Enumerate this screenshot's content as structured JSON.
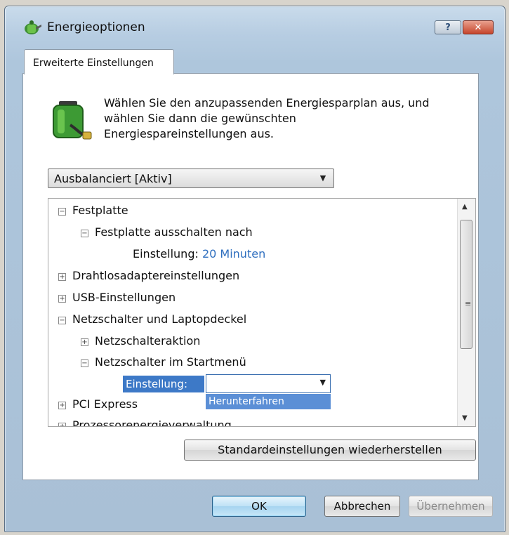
{
  "window": {
    "title": "Energieoptionen",
    "help_label": "?",
    "close_label": "✕"
  },
  "tab": {
    "label": "Erweiterte Einstellungen"
  },
  "intro": {
    "line1": "Wählen Sie den anzupassenden Energiesparplan aus, und",
    "line2": "wählen Sie dann die gewünschten",
    "line3": "Energiespareinstellungen aus."
  },
  "plan_select": {
    "value": "Ausbalanciert [Aktiv]"
  },
  "tree": {
    "items": [
      {
        "label": "Festplatte",
        "toggle": "⊟"
      },
      {
        "label": "Festplatte ausschalten nach",
        "toggle": "⊟"
      },
      {
        "label": "Einstellung:",
        "value": "20 Minuten"
      },
      {
        "label": "Drahtlosadaptereinstellungen",
        "toggle": "⊞"
      },
      {
        "label": "USB-Einstellungen",
        "toggle": "⊞"
      },
      {
        "label": "Netzschalter und Laptopdeckel",
        "toggle": "⊟"
      },
      {
        "label": "Netzschalteraktion",
        "toggle": "⊞"
      },
      {
        "label": "Netzschalter im Startmenü",
        "toggle": "⊟"
      },
      {
        "label": "Einstellung:"
      },
      {
        "label": "PCI Express",
        "toggle": "⊞"
      },
      {
        "label": "Prozessorenergieverwaltung",
        "toggle": "⊞"
      }
    ],
    "dropdown_option": "Herunterfahren"
  },
  "buttons": {
    "restore": "Standardeinstellungen wiederherstellen",
    "ok": "OK",
    "cancel": "Abbrechen",
    "apply": "Übernehmen"
  },
  "colors": {
    "accent": "#3d79c7",
    "link": "#2f6fbf",
    "frame": "#aec6dc"
  }
}
